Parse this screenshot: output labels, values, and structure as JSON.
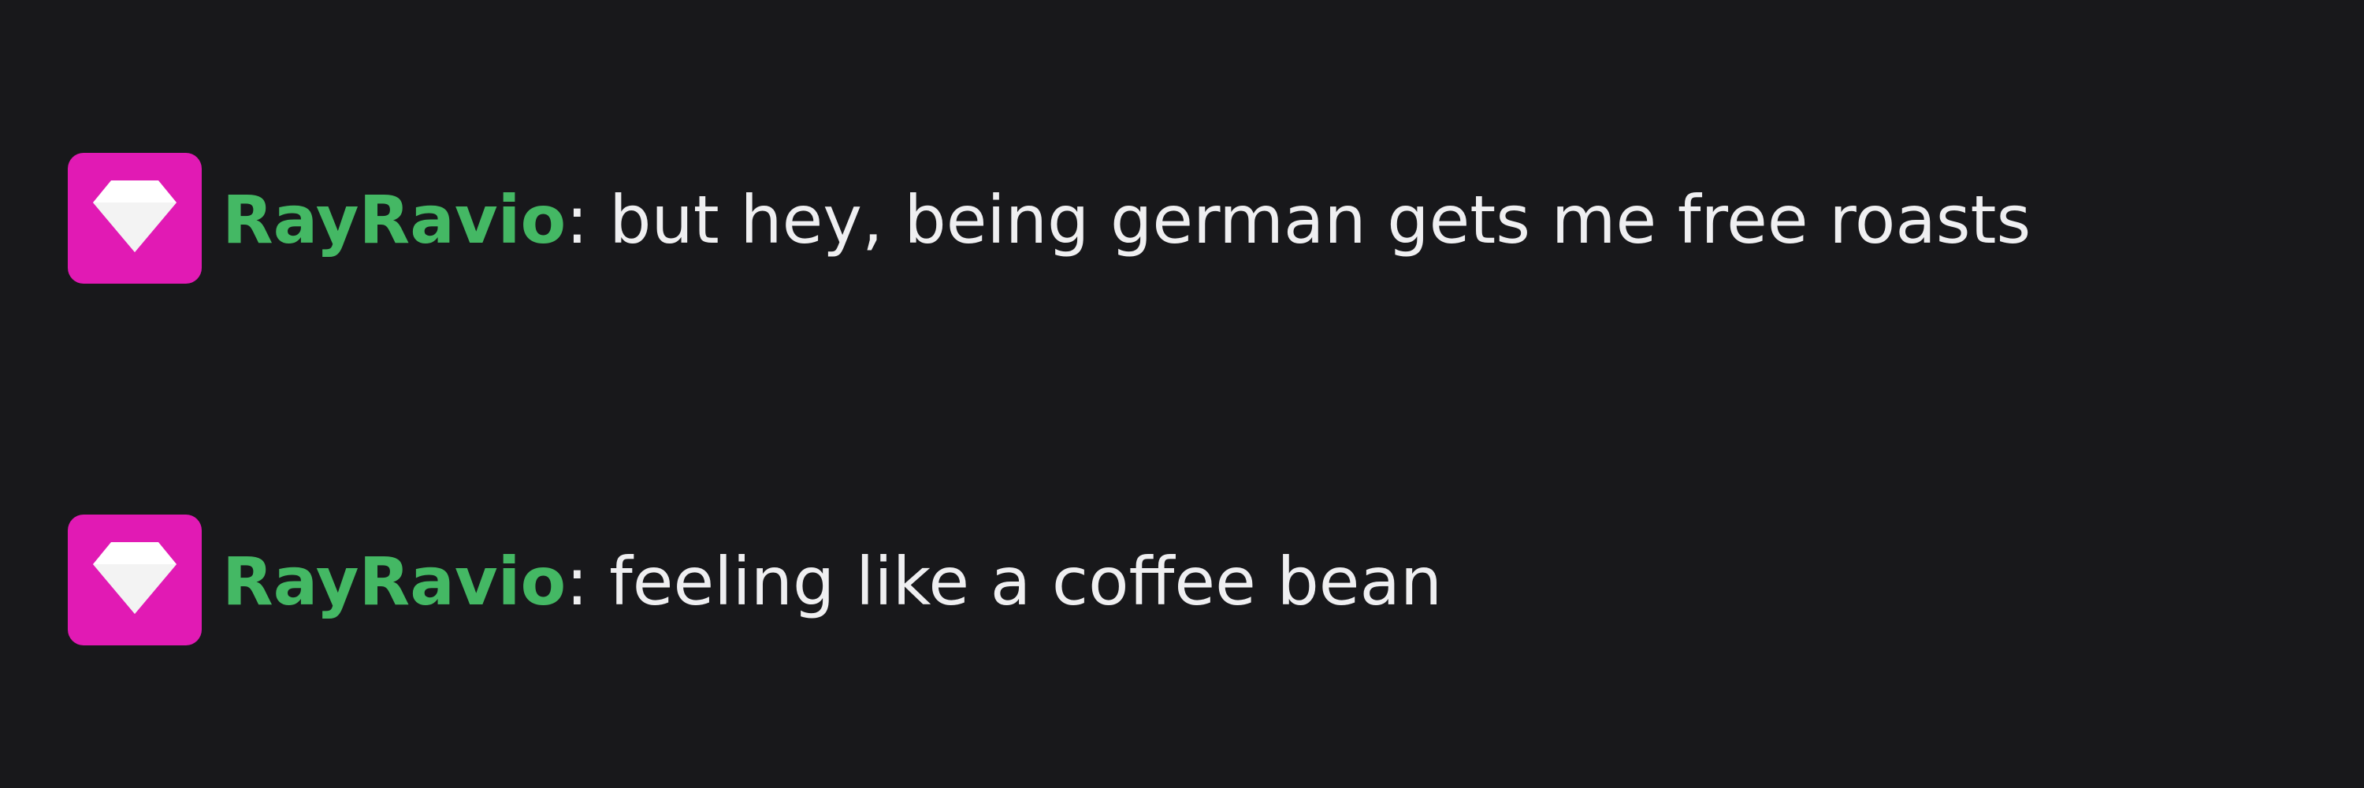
{
  "theme": {
    "background": "#18181b",
    "text_color": "#efeff1",
    "badge_color": "#e11ab4",
    "badge_icon_color": "#ffffff"
  },
  "chat": {
    "messages": [
      {
        "badge_icon": "diamond-icon",
        "username": "RayRavio",
        "username_color": "#44b864",
        "separator": ":",
        "text": " but hey, being german gets me free roasts"
      },
      {
        "badge_icon": "diamond-icon",
        "username": "RayRavio",
        "username_color": "#44b864",
        "separator": ":",
        "text": " feeling like a coffee bean"
      }
    ]
  }
}
